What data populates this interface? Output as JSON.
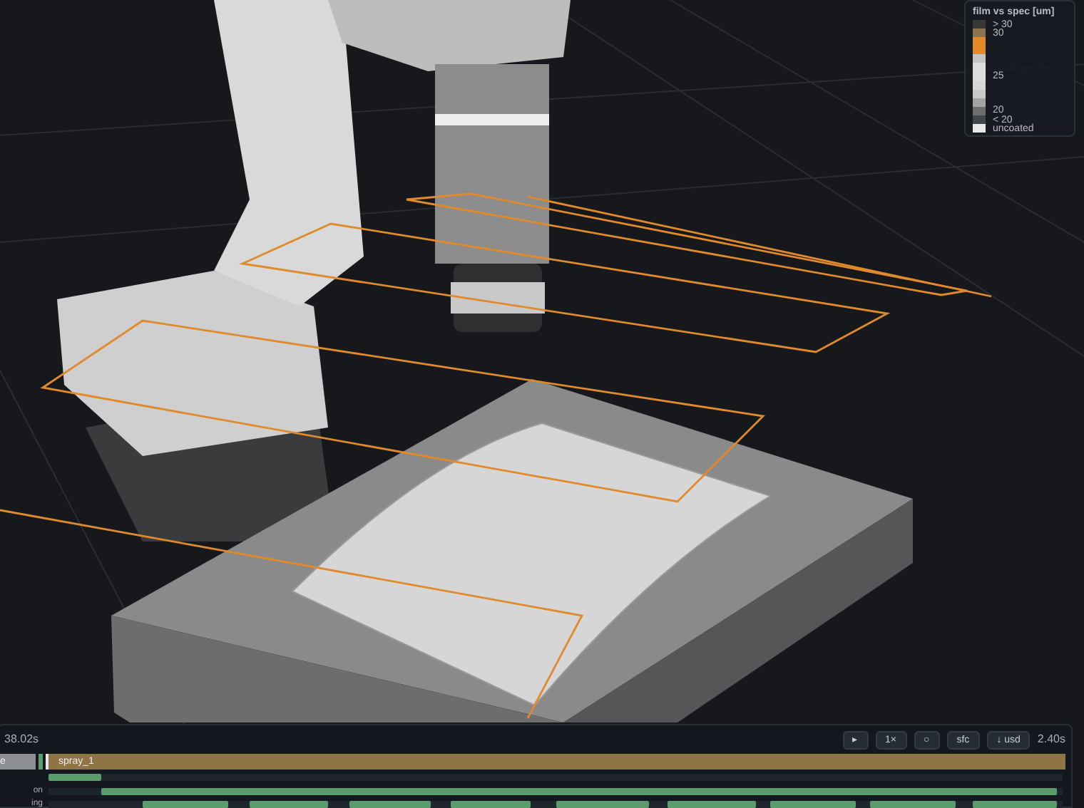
{
  "legend": {
    "title": "film vs spec [um]",
    "items": [
      {
        "color": "#3a3835",
        "label": "> 30"
      },
      {
        "color": "#8a7550",
        "label": "30"
      },
      {
        "color": "#e08a2c"
      },
      {
        "color": "#e08a2c"
      },
      {
        "color": "#c4c4c4"
      },
      {
        "color": "#dcdcdc"
      },
      {
        "color": "#dcdcdc",
        "label": "25"
      },
      {
        "color": "#d6d6d6"
      },
      {
        "color": "#c8c8c8"
      },
      {
        "color": "#a4a4a4"
      },
      {
        "color": "#6e6e6e",
        "label": "20"
      },
      {
        "color": "#3e4a48",
        "label": "< 20"
      },
      {
        "color": "#e8e8e8",
        "label": "uncoated"
      }
    ]
  },
  "timeline": {
    "time": "38.02s",
    "duration": "2.40s",
    "buttons": [
      {
        "label": "▸"
      },
      {
        "label": "1×"
      },
      {
        "label": "○"
      },
      {
        "label": "sfc"
      },
      {
        "label": "↓ usd"
      }
    ],
    "clips": [
      {
        "kind": "idle",
        "label": "e"
      },
      {
        "kind": "spray",
        "label": "spray_1"
      }
    ],
    "tracks": [
      {
        "kind": "short"
      },
      {
        "label": "on",
        "kind": "long"
      },
      {
        "label": "ing",
        "kind": "pulses"
      }
    ]
  }
}
